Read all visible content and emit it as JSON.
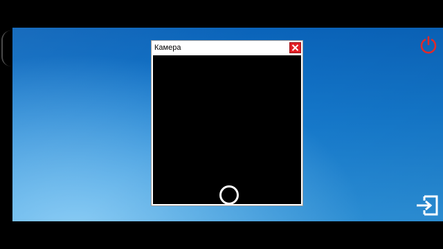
{
  "camera_window": {
    "title": "Камера"
  },
  "icons": {
    "close": "close-icon",
    "power": "power-icon",
    "exit": "exit-icon",
    "shutter": "shutter-icon"
  },
  "colors": {
    "desktop_top": "#0a63b9",
    "desktop_bottom": "#2d93dc",
    "close_button": "#e11f26",
    "power_icon": "#e02a2a",
    "exit_icon": "#ffffff",
    "camera_view": "#000000"
  }
}
